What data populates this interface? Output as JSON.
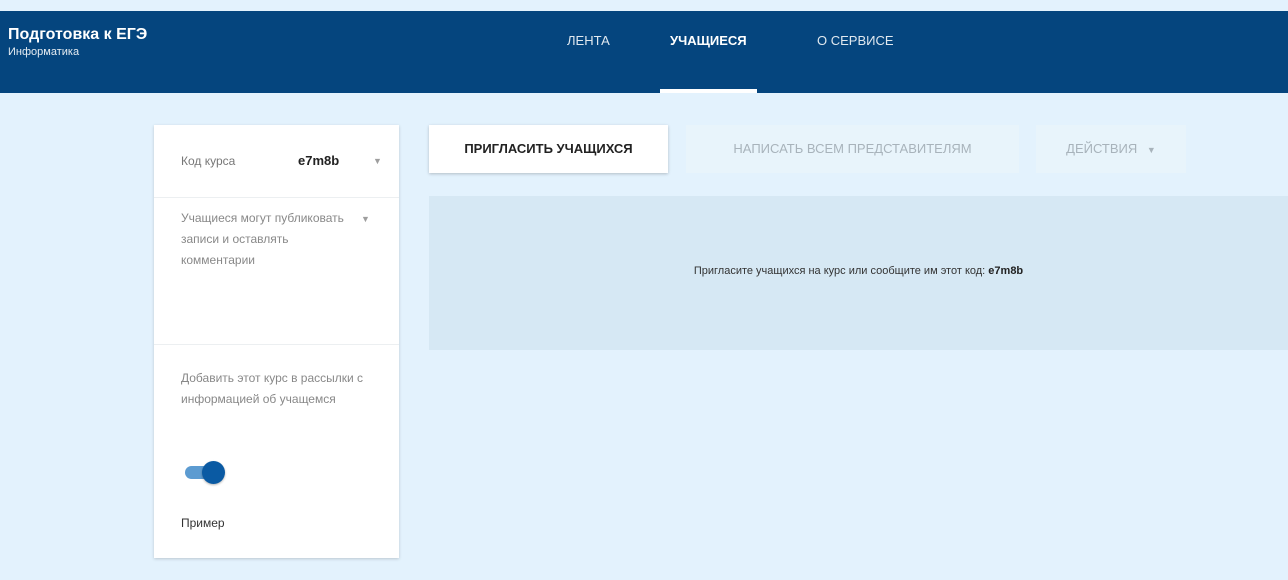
{
  "app": {
    "title": "Подготовка к ЕГЭ",
    "subtitle": "Информатика"
  },
  "tabs": [
    {
      "label": "Лента",
      "active": false
    },
    {
      "label": "Учащиеся",
      "active": true
    },
    {
      "label": "О сервисе",
      "active": false
    }
  ],
  "settings": {
    "code_label": "Код курса",
    "code_value": "e7m8b",
    "permission_text": "Учащиеся могут публиковать записи и оставлять комментарии",
    "mailing_text": "Добавить этот курс в рассылки с информацией об учащемся",
    "mailing_enabled": true,
    "example_label": "Пример"
  },
  "actions": {
    "invite_label": "Пригласить учащихся",
    "write_label": "Написать всем представителям",
    "actions_label": "Действия"
  },
  "empty_state": {
    "message": "Пригласите учащихся на курс или сообщите им этот код:",
    "code": "e7m8b"
  },
  "colors": {
    "header": "#05457e",
    "background": "#e3f2fd",
    "accent": "#0a5aa3"
  }
}
